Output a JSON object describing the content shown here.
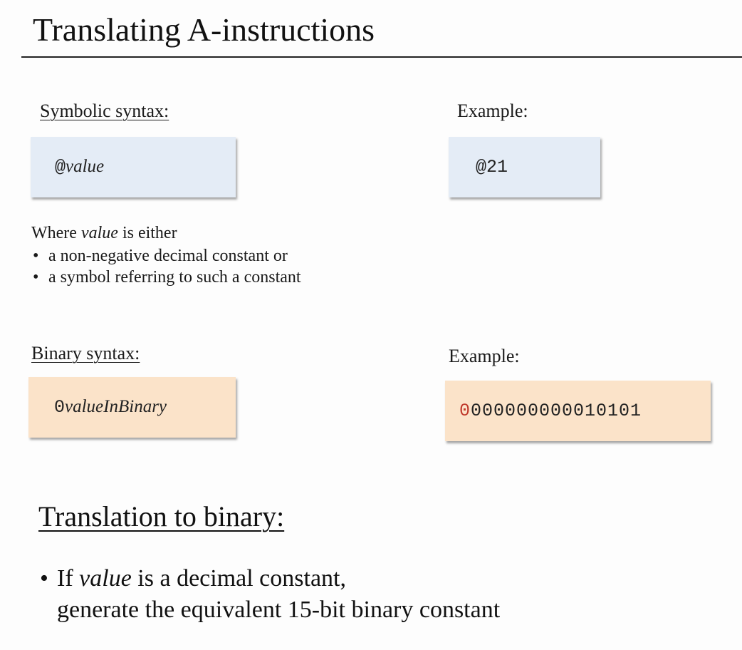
{
  "title": "Translating A-instructions",
  "symbolic": {
    "label": "Symbolic syntax:",
    "prefix": "@",
    "value": "value",
    "example_label": "Example:",
    "example": "@21"
  },
  "description": {
    "intro_prefix": "Where ",
    "intro_value": "value",
    "intro_suffix": " is either",
    "bullets": [
      "a non-negative decimal constant or",
      "a symbol referring to such a constant"
    ]
  },
  "binary": {
    "label": "Binary syntax:",
    "prefix": "0",
    "value": "valueInBinary",
    "example_label": "Example:",
    "example_first_bit": "0",
    "example_rest": "000000000010101"
  },
  "translation": {
    "heading": "Translation to binary:",
    "line1_prefix": "If ",
    "line1_value": "value",
    "line1_suffix": " is a decimal constant,",
    "line2": "generate the equivalent 15-bit binary constant"
  },
  "colors": {
    "symbolic_box": "#e4ecf6",
    "binary_box": "#fbe3c9",
    "first_bit": "#c0392b"
  }
}
